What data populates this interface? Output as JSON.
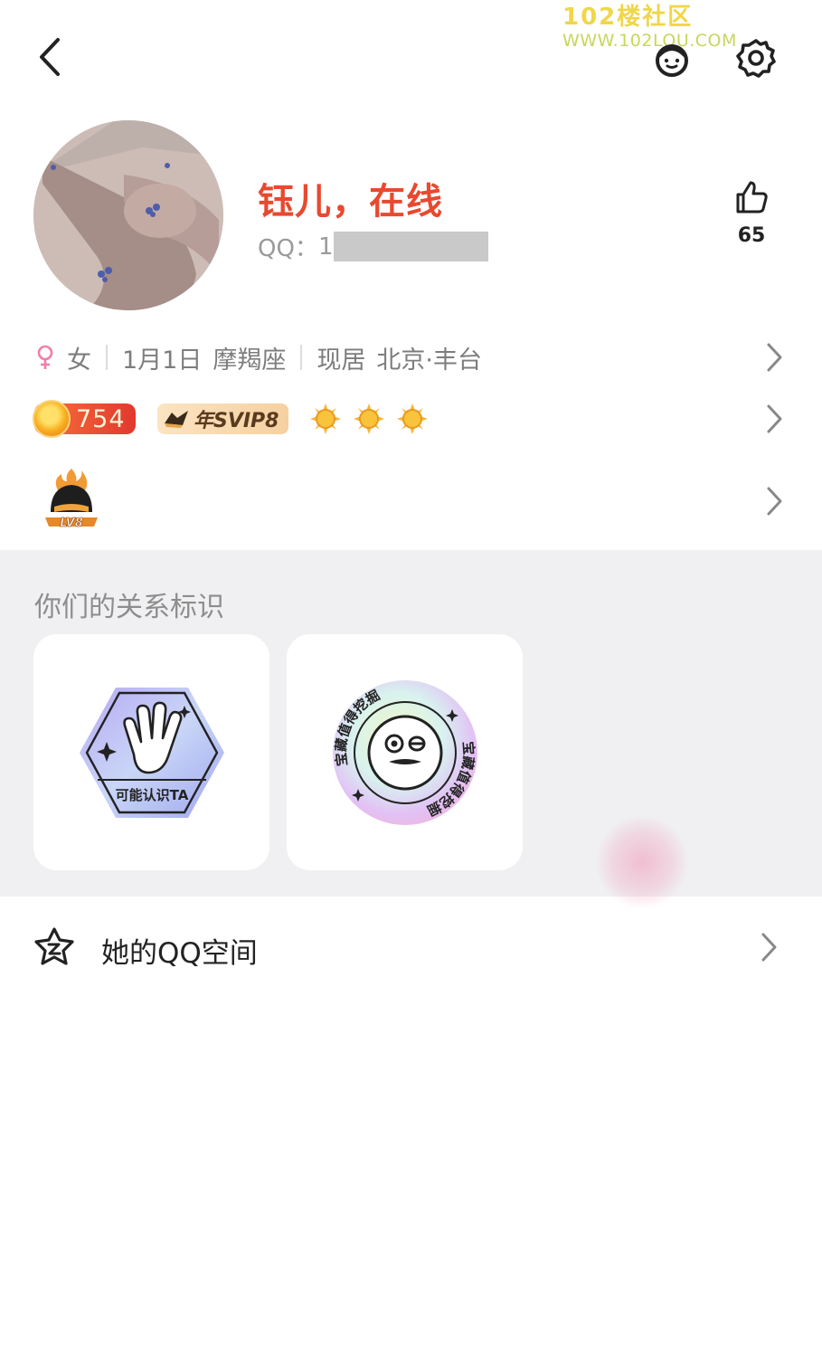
{
  "watermark": {
    "line1": "102楼社区",
    "line2": "WWW.102LOU.COM"
  },
  "topbar": {
    "back_icon": "chevron-left-icon",
    "outfit_icon": "avatar-outfit-icon",
    "settings_icon": "gear-icon"
  },
  "profile": {
    "name": "钰儿，在线",
    "name_color": "#e8492f",
    "qq_label": "QQ：",
    "qq_visible": "1",
    "like_icon": "thumbs-up-icon",
    "like_count": "65"
  },
  "info": {
    "gender_icon": "female-icon",
    "gender": "女",
    "birthday": "1月1日",
    "zodiac": "摩羯座",
    "location_label": "现居",
    "location": "北京·丰台"
  },
  "badges": {
    "level_number": "754",
    "svip_label": "年SVIP8",
    "sun_icons": [
      "sun-icon",
      "sun-icon",
      "sun-icon"
    ]
  },
  "lv_badge": {
    "label": "LV8"
  },
  "relationship": {
    "title": "你们的关系标识",
    "cards": [
      {
        "label": "可能认识TA",
        "icon": "waving-hand-icon"
      },
      {
        "label": "宝藏值得挖掘",
        "icon": "smiley-face-icon"
      }
    ]
  },
  "zone": {
    "icon": "qzone-star-icon",
    "label": "她的QQ空间"
  }
}
